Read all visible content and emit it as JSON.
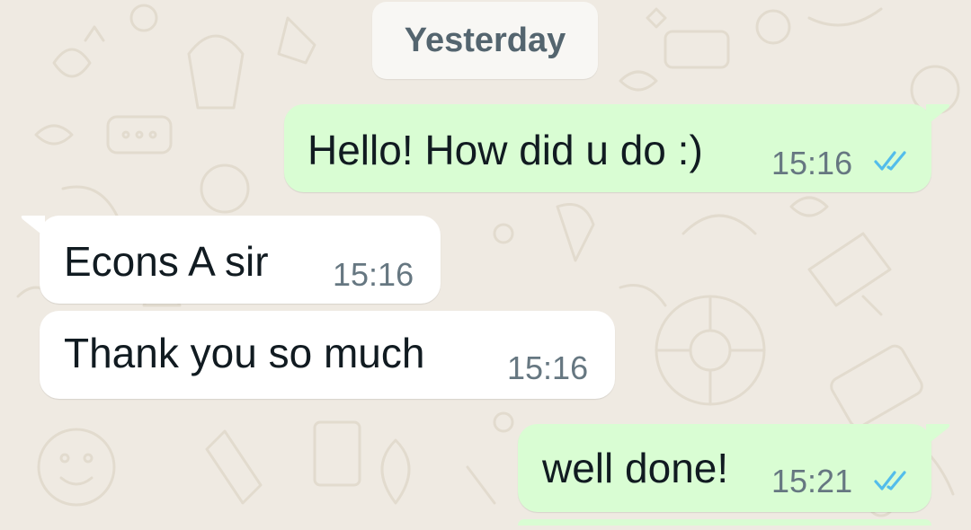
{
  "chat": {
    "date_separator": "Yesterday",
    "messages": [
      {
        "direction": "outgoing",
        "text": "Hello! How did u do :)",
        "time": "15:16",
        "status_icon": "double-check-read-icon"
      },
      {
        "direction": "incoming",
        "text": "Econs A sir",
        "time": "15:16"
      },
      {
        "direction": "incoming",
        "text": "Thank you so much",
        "time": "15:16"
      },
      {
        "direction": "outgoing",
        "text": "well done!",
        "time": "15:21",
        "status_icon": "double-check-read-icon"
      }
    ]
  },
  "colors": {
    "wallpaper": "#efeae2",
    "outgoing_bubble": "#d9fdd3",
    "incoming_bubble": "#ffffff",
    "read_ticks": "#53bdeb",
    "timestamp": "#667781"
  }
}
